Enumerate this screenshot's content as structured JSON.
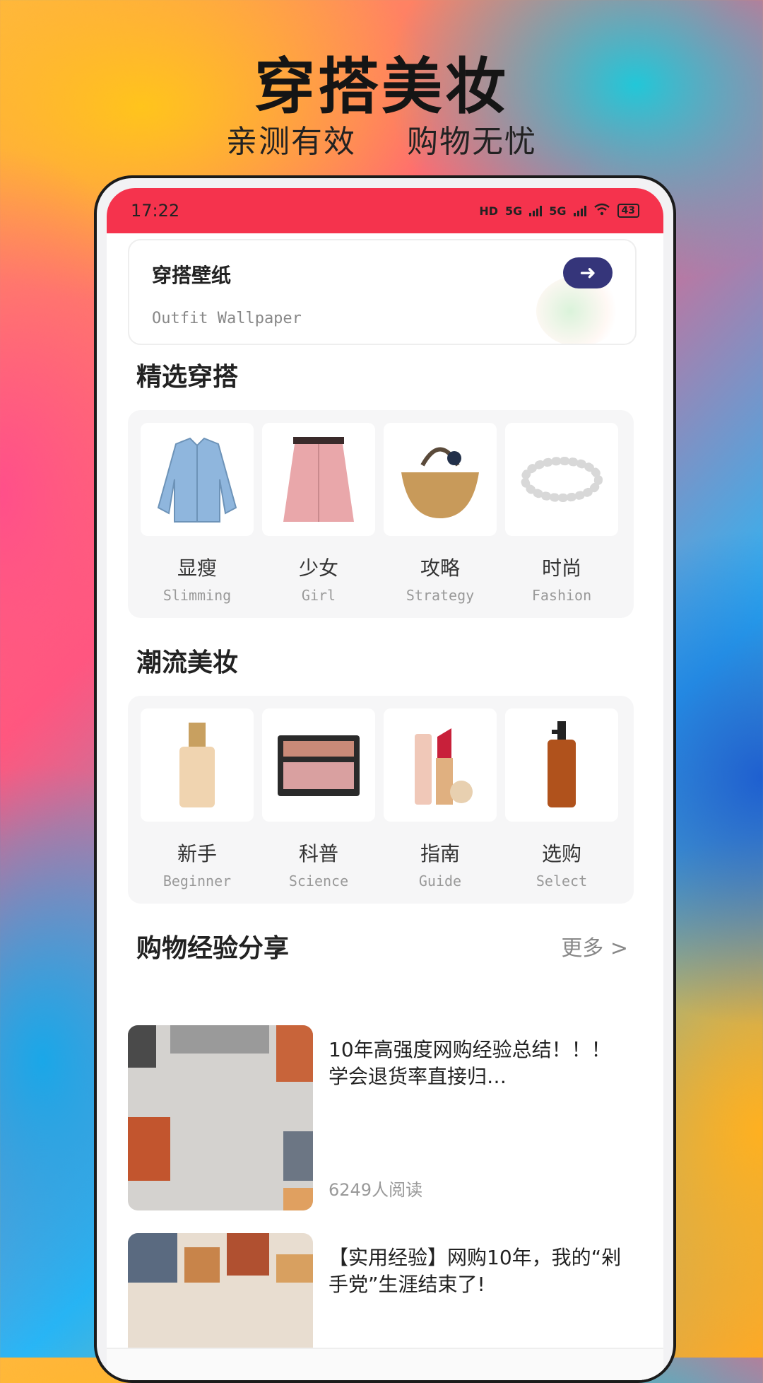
{
  "hero": {
    "title": "穿搭美妆",
    "sub_left": "亲测有效",
    "sub_right": "购物无忧"
  },
  "status": {
    "time": "17:22",
    "battery": "43",
    "network1": "5G",
    "network2": "5G",
    "hd": "HD"
  },
  "banner": {
    "title": "穿搭壁纸",
    "subtitle": "Outfit Wallpaper",
    "button": "➜"
  },
  "outfits": {
    "title": "精选穿搭",
    "items": [
      {
        "label": "显瘦",
        "sub": "Slimming"
      },
      {
        "label": "少女",
        "sub": "Girl"
      },
      {
        "label": "攻略",
        "sub": "Strategy"
      },
      {
        "label": "时尚",
        "sub": "Fashion"
      }
    ]
  },
  "makeup": {
    "title": "潮流美妆",
    "items": [
      {
        "label": "新手",
        "sub": "Beginner"
      },
      {
        "label": "科普",
        "sub": "Science"
      },
      {
        "label": "指南",
        "sub": "Guide"
      },
      {
        "label": "选购",
        "sub": "Select"
      }
    ]
  },
  "shopping": {
    "title": "购物经验分享",
    "more": "更多  >",
    "articles": [
      {
        "title": "10年高强度网购经验总结！！！ 学会退货率直接归…",
        "reads": "6249人阅读"
      },
      {
        "title": "【实用经验】网购10年，我的“剁手党”生涯结束了!",
        "reads": ""
      }
    ]
  },
  "colors": {
    "status_bar": "#f5334d",
    "banner_button": "#35357a"
  }
}
